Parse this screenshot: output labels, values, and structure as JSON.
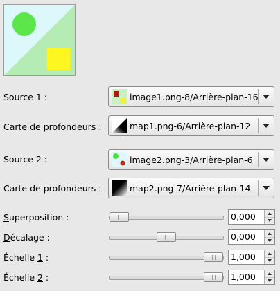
{
  "preview": {
    "bg_color": "#ddf8fb",
    "triangle_color": "#b5ecb3",
    "circle_color": "#5de64a",
    "square_color": "#fdf620"
  },
  "rows": {
    "source1": {
      "label": "Source 1 :",
      "value": "image1.png-8/Arrière-plan-16"
    },
    "depth1": {
      "label": "Carte de profondeurs :",
      "value": "map1.png-6/Arrière-plan-12"
    },
    "source2": {
      "label": "Source 2 :",
      "value": "image2.png-3/Arrière-plan-6"
    },
    "depth2": {
      "label": "Carte de profondeurs :",
      "value": "map2.png-7/Arrière-plan-14"
    }
  },
  "sliders": {
    "overlap": {
      "mnemonic": "S",
      "rest": "uperposition :",
      "value": "0,000",
      "level": 0.0
    },
    "offset": {
      "mnemonic": "D",
      "rest": "écalage :",
      "value": "0,000",
      "level": 0.5
    },
    "scale1": {
      "prefix": "Échelle ",
      "mnemonic": "1",
      "suffix": " :",
      "value": "1,000",
      "level": 1.0
    },
    "scale2": {
      "prefix": "Échelle ",
      "mnemonic": "2",
      "suffix": " :",
      "value": "1,000",
      "level": 1.0
    }
  }
}
